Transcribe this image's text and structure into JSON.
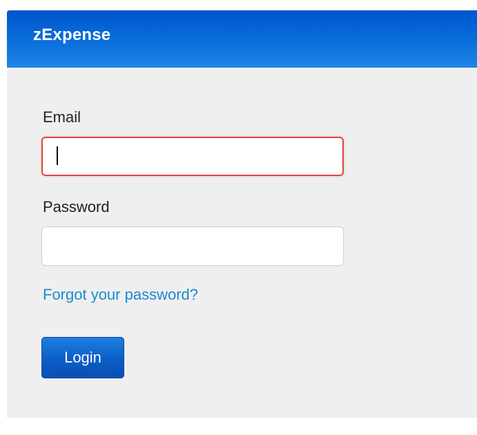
{
  "app": {
    "title": "zExpense"
  },
  "form": {
    "email_label": "Email",
    "email_value": "",
    "email_state": "invalid",
    "email_border_color": "#e0483e",
    "password_label": "Password",
    "password_value": "",
    "forgot_link": "Forgot your password?",
    "login_button": "Login"
  },
  "colors": {
    "header": "#0a6fdb",
    "link": "#1a8ad0",
    "button": "#0a5ec8",
    "background": "#efefef"
  }
}
